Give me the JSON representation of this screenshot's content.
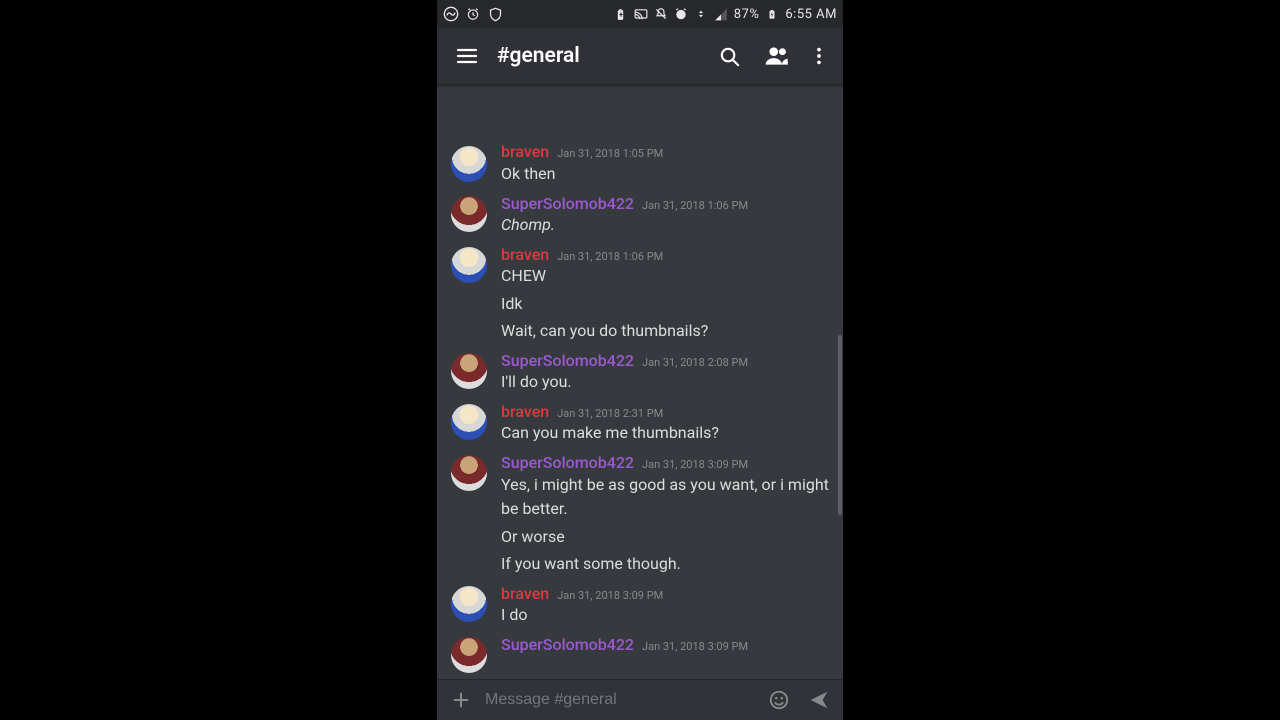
{
  "statusbar": {
    "battery_text": "87%",
    "time_text": "6:55 AM"
  },
  "topbar": {
    "channel": "#general"
  },
  "users": {
    "braven": "braven",
    "super": "SuperSolomob422"
  },
  "messages": [
    {
      "user": "braven",
      "time": "Jan 31, 2018 1:05 PM",
      "lines": [
        "Ok then"
      ],
      "cut_top": true
    },
    {
      "user": "super",
      "time": "Jan 31, 2018 1:06 PM",
      "lines": [
        "Chomp."
      ],
      "italic": true
    },
    {
      "user": "braven",
      "time": "Jan 31, 2018 1:06 PM",
      "lines": [
        "CHEW",
        "Idk",
        "Wait, can you do thumbnails?"
      ]
    },
    {
      "user": "super",
      "time": "Jan 31, 2018 2:08 PM",
      "lines": [
        "I'll do you."
      ]
    },
    {
      "user": "braven",
      "time": "Jan 31, 2018 2:31 PM",
      "lines": [
        "Can you make me thumbnails?"
      ]
    },
    {
      "user": "super",
      "time": "Jan 31, 2018 3:09 PM",
      "lines": [
        "Yes, i might be as good as you want, or i might be better.",
        "Or worse",
        "If you want some though."
      ]
    },
    {
      "user": "braven",
      "time": "Jan 31, 2018 3:09 PM",
      "lines": [
        "I do"
      ]
    },
    {
      "user": "super",
      "time": "Jan 31, 2018 3:09 PM",
      "lines": [],
      "cut_bottom": true
    }
  ],
  "input": {
    "placeholder": "Message #general"
  }
}
